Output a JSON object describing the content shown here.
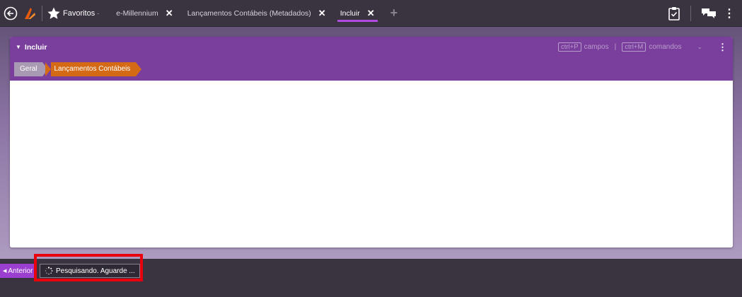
{
  "topbar": {
    "favorites_label": "Favoritos",
    "favorites_caret": "-",
    "tabs": [
      {
        "label": "e-Millennium",
        "close": "✕"
      },
      {
        "label": "Lançamentos Contábeis (Metadados)",
        "close": "✕"
      },
      {
        "label": "Incluir",
        "close": "✕"
      }
    ],
    "add_tab": "+",
    "menu": "⋮"
  },
  "panel": {
    "title": "Incluir",
    "caret": "▼",
    "shortcut_fields_key": "ctrl+P",
    "shortcut_fields_label": "campos",
    "separator": "|",
    "shortcut_commands_key": "ctrl+M",
    "shortcut_commands_label": "comandos",
    "chevron": "⌄",
    "menu": "⋮",
    "breadcrumb": [
      "Geral",
      "Lançamentos Contábeis"
    ]
  },
  "bottombar": {
    "prev_label": "Anterior",
    "prev_arrow": "◀",
    "status_text": "Pesquisando. Aguarde ..."
  },
  "colors": {
    "accent": "#7a3f9c",
    "breadcrumb_active": "#d46a16",
    "highlight": "#e8000d",
    "topbar": "#3a3340"
  }
}
